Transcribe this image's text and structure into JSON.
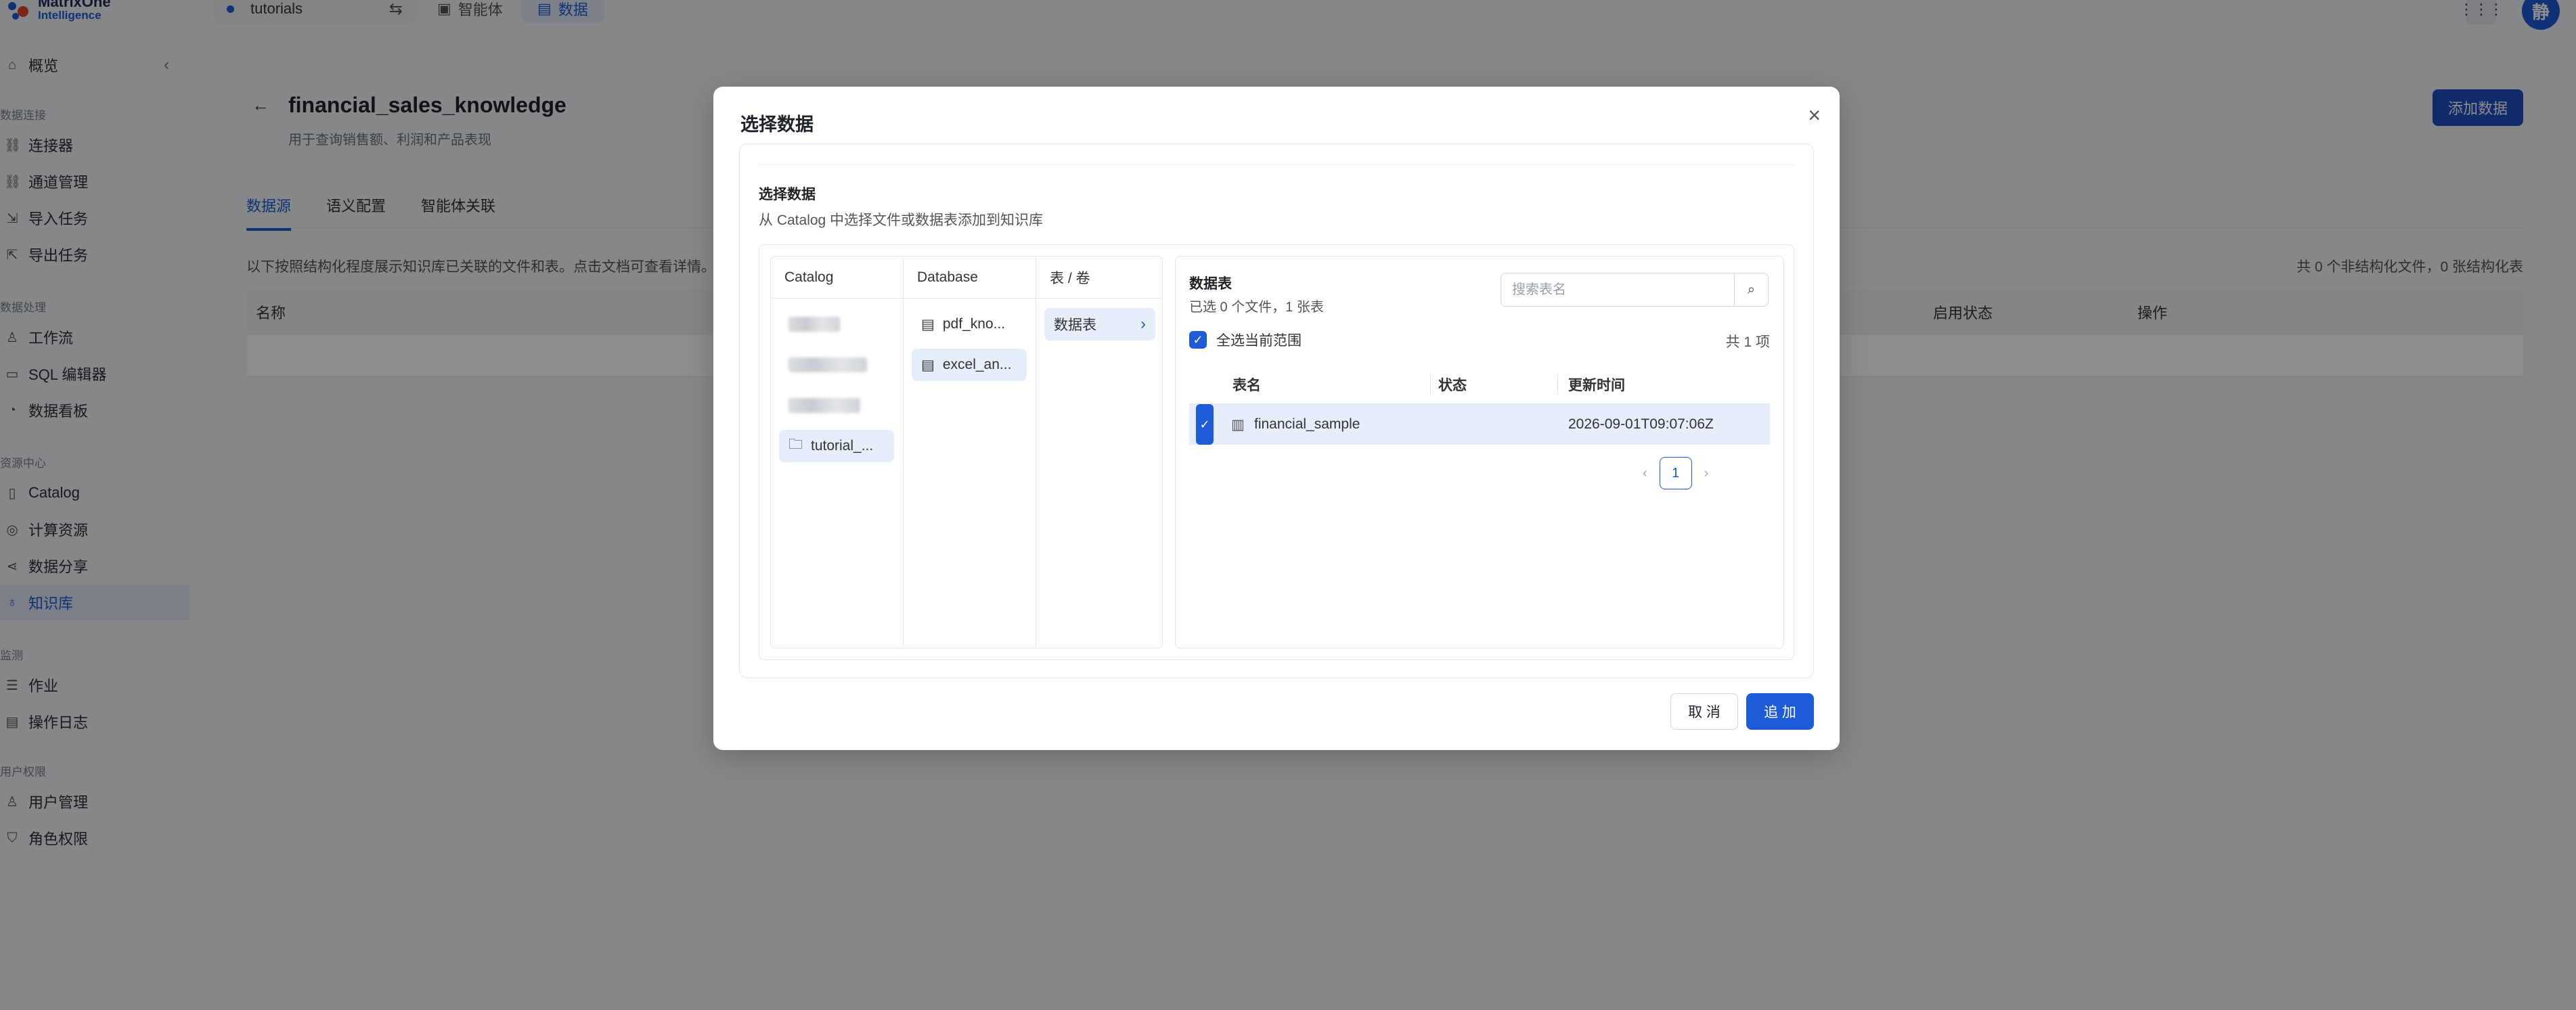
{
  "topbar": {
    "logo_line1": "MatrixOne",
    "logo_line2": "Intelligence",
    "workspace": "tutorials",
    "workspace_switch_icon": "swap-icon",
    "tabs": [
      {
        "label": "智能体",
        "icon": "agent-icon",
        "active": false
      },
      {
        "label": "数据",
        "icon": "data-icon",
        "active": true
      }
    ],
    "avatar_text": "静"
  },
  "sidebar": {
    "overview": "概览",
    "groups": [
      {
        "title": "数据连接",
        "items": [
          "连接器",
          "通道管理",
          "导入任务",
          "导出任务"
        ]
      },
      {
        "title": "数据处理",
        "items": [
          "工作流",
          "SQL 编辑器",
          "数据看板"
        ]
      },
      {
        "title": "资源中心",
        "items": [
          "Catalog",
          "计算资源",
          "数据分享",
          "知识库"
        ]
      },
      {
        "title": "监测",
        "items": [
          "作业",
          "操作日志"
        ]
      },
      {
        "title": "用户权限",
        "items": [
          "用户管理",
          "角色权限"
        ]
      }
    ],
    "active_item": "知识库"
  },
  "main": {
    "title": "financial_sales_knowledge",
    "subtitle": "用于查询销售额、利润和产品表现",
    "add_button": "添加数据",
    "tabs": [
      "数据源",
      "语义配置",
      "智能体关联"
    ],
    "description": "以下按照结构化程度展示知识库已关联的文件和表。点击文档可查看详情。",
    "count_text": "共 0 个非结构化文件，0 张结构化表",
    "table_headers": [
      "名称",
      "启用状态",
      "操作"
    ]
  },
  "modal": {
    "title": "选择数据",
    "section_label": "选择数据",
    "section_desc": "从 Catalog 中选择文件或数据表添加到知识库",
    "columns": {
      "catalog": {
        "header": "Catalog",
        "items": [
          "tutorial_..."
        ]
      },
      "database": {
        "header": "Database",
        "items": [
          "pdf_kno...",
          "excel_an..."
        ]
      },
      "table_volume": {
        "header": "表 / 卷",
        "items": [
          "数据表"
        ]
      }
    },
    "tables_panel": {
      "title": "数据表",
      "selected_text": "已选 0 个文件，1 张表",
      "search_placeholder": "搜索表名",
      "select_all_label": "全选当前范围",
      "total_text": "共 1 项",
      "headers": [
        "表名",
        "状态",
        "更新时间"
      ],
      "rows": [
        {
          "name": "financial_sample",
          "status": "",
          "updated": "2026-09-01T09:07:06Z",
          "checked": true
        }
      ],
      "page": "1"
    },
    "cancel_button": "取 消",
    "add_button": "追 加"
  },
  "colors": {
    "accent": "#1d5bd8",
    "overlay": "rgba(0,0,0,0.45)"
  }
}
